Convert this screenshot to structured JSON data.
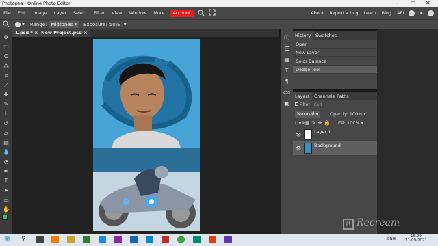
{
  "window": {
    "title": "Photopea | Online Photo Editor",
    "minimize": "–",
    "maximize": "□",
    "close": "✕"
  },
  "menu": {
    "items": [
      "File",
      "Edit",
      "Image",
      "Layer",
      "Select",
      "Filter",
      "View",
      "Window",
      "More"
    ],
    "account": "Account",
    "right_items": [
      "About",
      "Report a bug",
      "Learn",
      "Blog",
      "API"
    ]
  },
  "options": {
    "range_label": "Range:",
    "range_value": "Midtones",
    "exposure_label": "Exposure:",
    "exposure_value": "50%"
  },
  "tabs": [
    {
      "label": "1.psd *",
      "close": "×"
    },
    {
      "label": "New Project.psd",
      "close": "×"
    }
  ],
  "history": {
    "tabs": [
      "History",
      "Swatches"
    ],
    "items": [
      "Open",
      "New Layer",
      "Color Balance",
      "Dodge Tool"
    ]
  },
  "layers": {
    "tabs": [
      "Layers",
      "Channels",
      "Paths"
    ],
    "filter_label": "Filter",
    "filter_kind": "Knd",
    "blend_mode": "Normal",
    "opacity_label": "Opacity:",
    "opacity_value": "100%",
    "lock_label": "Lock:",
    "fill_label": "Fill:",
    "fill_value": "100%",
    "items": [
      {
        "name": "Layer 1"
      },
      {
        "name": "Background"
      }
    ]
  },
  "side_icons": {
    "css_label": "CSS"
  },
  "watermark": "Recream",
  "taskbar": {
    "lang": "ENG",
    "time": "16:29",
    "date": "11-09-2021"
  },
  "colors": {
    "accent_red": "#e41e1e",
    "fg_swatch": "#22c26a",
    "bg_swatch": "#ffffff",
    "selected_layer": "#5f5f5f"
  }
}
